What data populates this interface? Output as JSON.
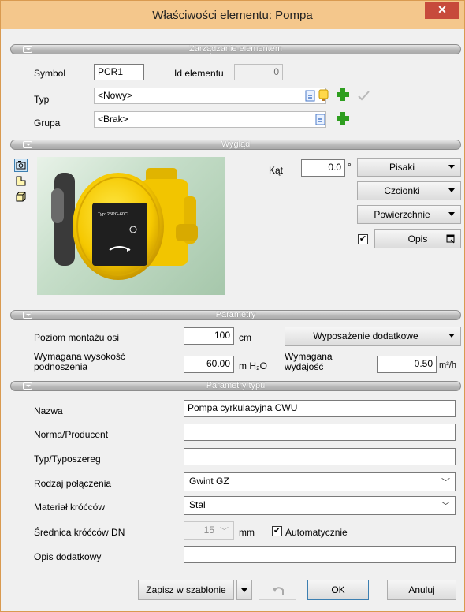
{
  "window": {
    "title": "Właściwości elementu: Pompa",
    "close_glyph": "✕"
  },
  "sections": {
    "management": "Zarządzanie elementem",
    "appearance": "Wygląd",
    "parameters": "Parametry",
    "type_parameters": "Parametry typu"
  },
  "management": {
    "symbol_label": "Symbol",
    "symbol_value": "PCR1",
    "id_label": "Id elementu",
    "id_value": "0",
    "type_label": "Typ",
    "type_value": "<Nowy>",
    "group_label": "Grupa",
    "group_value": "<Brak>"
  },
  "appearance": {
    "angle_label": "Kąt",
    "angle_value": "0.0",
    "angle_unit": "°",
    "pens_button": "Pisaki",
    "fonts_button": "Czcionki",
    "surfaces_button": "Powierzchnie",
    "description_checkbox_checked": true,
    "description_button": "Opis",
    "pump_label": "Typ: 25PG-60C"
  },
  "parameters": {
    "axis_level_label": "Poziom montażu osi",
    "axis_level_value": "100",
    "axis_level_unit": "cm",
    "extra_equipment_button": "Wyposażenie dodatkowe",
    "required_height_label": "Wymagana wysokość podnoszenia",
    "required_height_value": "60.00",
    "required_height_unit": "m H₂O",
    "required_flow_label": "Wymagana wydajość",
    "required_flow_value": "0.50",
    "required_flow_unit": "m³/h"
  },
  "type_parameters": {
    "name_label": "Nazwa",
    "name_value": "Pompa cyrkulacyjna CWU",
    "norm_label": "Norma/Producent",
    "norm_value": "",
    "series_label": "Typ/Typoszereg",
    "series_value": "",
    "connection_label": "Rodzaj połączenia",
    "connection_value": "Gwint GZ",
    "material_label": "Materiał króćców",
    "material_value": "Stal",
    "dn_label": "Średnica króćców DN",
    "dn_value": "15",
    "dn_unit": "mm",
    "auto_label": "Automatycznie",
    "auto_checked": true,
    "extra_desc_label": "Opis dodatkowy",
    "extra_desc_value": ""
  },
  "footer": {
    "save_template_button": "Zapisz w szablonie",
    "ok_button": "OK",
    "cancel_button": "Anuluj"
  },
  "colors": {
    "titlebar": "#f4c78c",
    "close_button": "#c74a3b",
    "section_header": "#b3b3b3",
    "pump_yellow": "#f5d000",
    "add_green": "#2e9e1f"
  }
}
